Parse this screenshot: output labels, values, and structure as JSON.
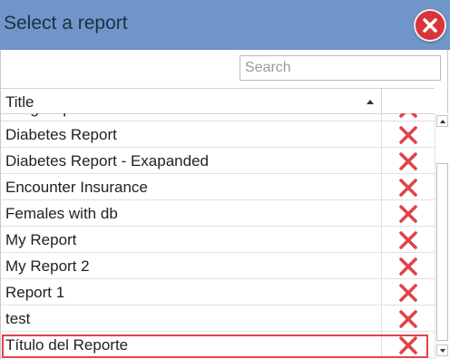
{
  "dialog": {
    "title": "Select a report"
  },
  "search": {
    "value": "",
    "placeholder": "Search"
  },
  "grid": {
    "columns": [
      "Title",
      ""
    ],
    "sort": "ascending",
    "rows": [
      {
        "title": "Drug Report"
      },
      {
        "title": "Diabetes Report"
      },
      {
        "title": "Diabetes Report - Exapanded"
      },
      {
        "title": "Encounter Insurance"
      },
      {
        "title": "Females with db"
      },
      {
        "title": "My Report"
      },
      {
        "title": "My Report 2"
      },
      {
        "title": "Report 1"
      },
      {
        "title": "test"
      },
      {
        "title": "Título del Reporte"
      }
    ],
    "highlighted_row": "Título del Reporte"
  },
  "colors": {
    "titlebar": "#6f95c9",
    "close": "#d9343b",
    "delete": "#e0434a",
    "highlight": "#e0434a"
  },
  "icons": {
    "close": "close-icon",
    "delete": "delete-x-icon",
    "sort": "sort-ascending-icon"
  }
}
